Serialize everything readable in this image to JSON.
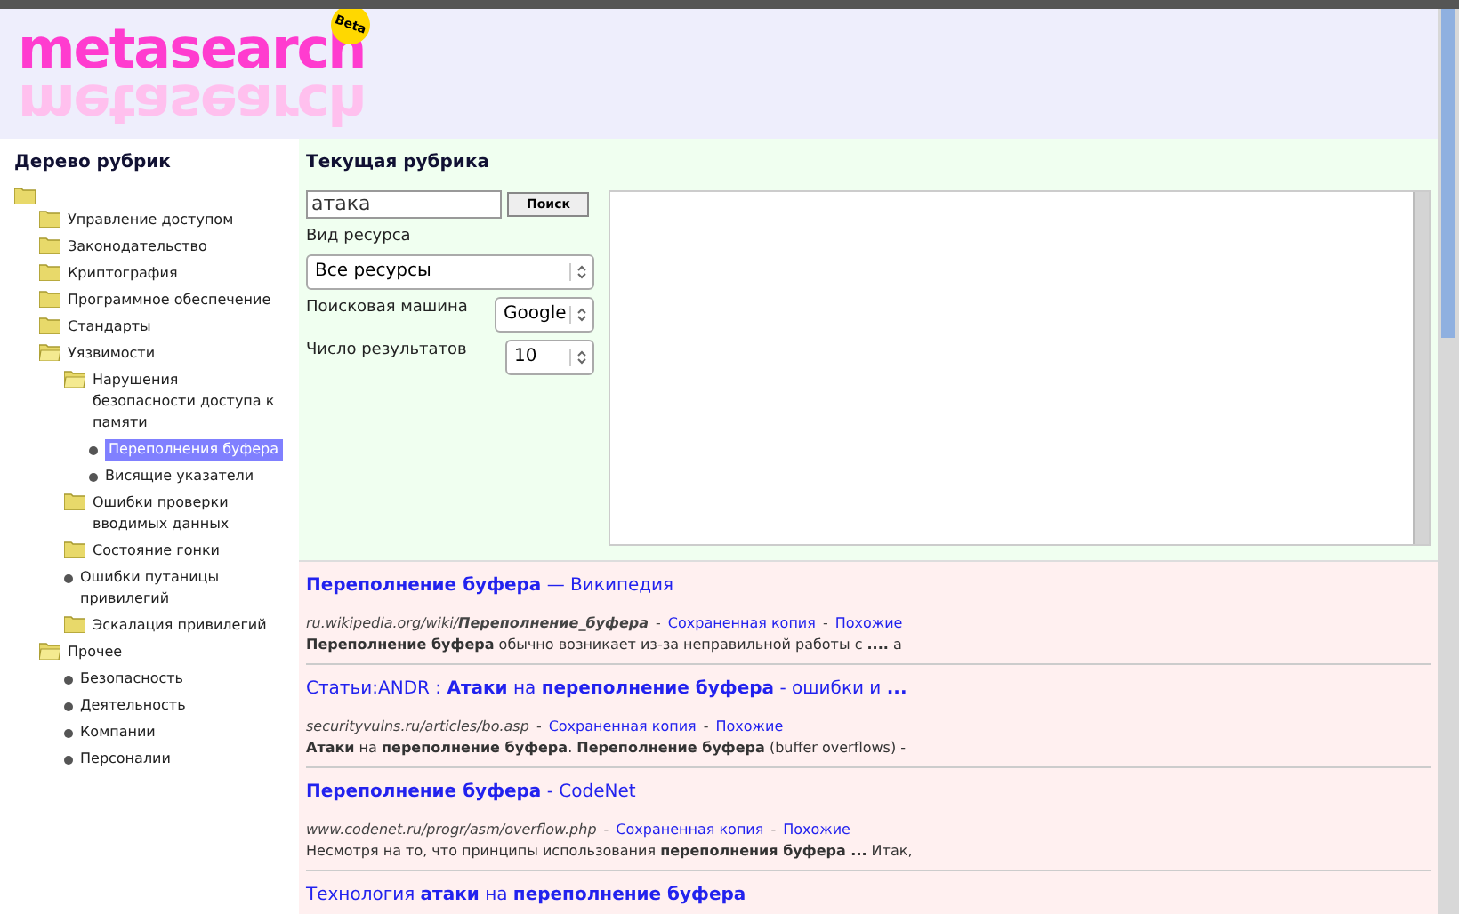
{
  "logo": {
    "text": "metasearch",
    "reflection": "metasearch",
    "badge": "Beta"
  },
  "tree": {
    "title": "Дерево рубрик",
    "root": {
      "kind": "folder",
      "children": [
        {
          "label": "Управление доступом",
          "kind": "folder",
          "selected": false
        },
        {
          "label": "Законодательство",
          "kind": "folder",
          "selected": false
        },
        {
          "label": "Криптография",
          "kind": "folder",
          "selected": false
        },
        {
          "label": "Программное обеспечение",
          "kind": "folder",
          "selected": false
        },
        {
          "label": "Стандарты",
          "kind": "folder",
          "selected": false
        },
        {
          "label": "Уязвимости",
          "kind": "open-folder",
          "selected": false,
          "children": [
            {
              "label": "Нарушения безопасности доступа к памяти",
              "kind": "open-folder",
              "selected": false,
              "children": [
                {
                  "label": "Переполнения буфера",
                  "kind": "leaf",
                  "selected": true
                },
                {
                  "label": "Висящие указатели",
                  "kind": "leaf",
                  "selected": false
                }
              ]
            },
            {
              "label": "Ошибки проверки вводимых данных",
              "kind": "folder",
              "selected": false
            },
            {
              "label": "Состояние гонки",
              "kind": "folder",
              "selected": false
            },
            {
              "label": "Ошибки путаницы привилегий",
              "kind": "leaf",
              "selected": false
            },
            {
              "label": "Эскалация привилегий",
              "kind": "folder",
              "selected": false
            }
          ]
        },
        {
          "label": "Прочее",
          "kind": "open-folder",
          "selected": false,
          "children": [
            {
              "label": "Безопасность",
              "kind": "leaf",
              "selected": false
            },
            {
              "label": "Деятельность",
              "kind": "leaf",
              "selected": false
            },
            {
              "label": "Компании",
              "kind": "leaf",
              "selected": false
            },
            {
              "label": "Персоналии",
              "kind": "leaf",
              "selected": false
            }
          ]
        }
      ]
    }
  },
  "form": {
    "title": "Текущая рубрика",
    "query": "атака",
    "search_button": "Поиск",
    "resource_label": "Вид ресурса",
    "resource_value": "Все ресурсы",
    "engine_label": "Поисковая машина",
    "engine_value": "Google",
    "count_label": "Число результатов",
    "count_value": "10"
  },
  "results": [
    {
      "title": "**Переполнение буфера** — Википедия",
      "meta": [
        {
          "kind": "url",
          "text": "ru.wikipedia.org/wiki/**Переполнение_буфера**"
        },
        {
          "kind": "sep",
          "text": "-"
        },
        {
          "kind": "link",
          "text": "Сохраненная копия"
        },
        {
          "kind": "sep",
          "text": "-"
        },
        {
          "kind": "link",
          "text": "Похожие"
        }
      ],
      "snippet": "**Переполнение буфера** обычно возникает из-за неправильной работы с **....** а"
    },
    {
      "title": "Статьи:ANDR : **Атаки** на **переполнение буфера** - ошибки и **...**",
      "meta": [
        {
          "kind": "url",
          "text": "securityvulns.ru/articles/bo.asp"
        },
        {
          "kind": "sep",
          "text": "-"
        },
        {
          "kind": "link",
          "text": "Сохраненная копия"
        },
        {
          "kind": "sep",
          "text": "-"
        },
        {
          "kind": "link",
          "text": "Похожие"
        }
      ],
      "snippet": "**Атаки** на **переполнение буфера**. **Переполнение буфера** (buffer overflows) -"
    },
    {
      "title": "**Переполнение буфера** - CodeNet",
      "meta": [
        {
          "kind": "url",
          "text": "www.codenet.ru/progr/asm/overflow.php"
        },
        {
          "kind": "sep",
          "text": "-"
        },
        {
          "kind": "link",
          "text": "Сохраненная копия"
        },
        {
          "kind": "sep",
          "text": "-"
        },
        {
          "kind": "link",
          "text": "Похожие"
        }
      ],
      "snippet": "Несмотря на то, что принципы использования **переполнения буфера ...** Итак,"
    },
    {
      "title": "Технология **атаки** на **переполнение буфера**"
    }
  ]
}
